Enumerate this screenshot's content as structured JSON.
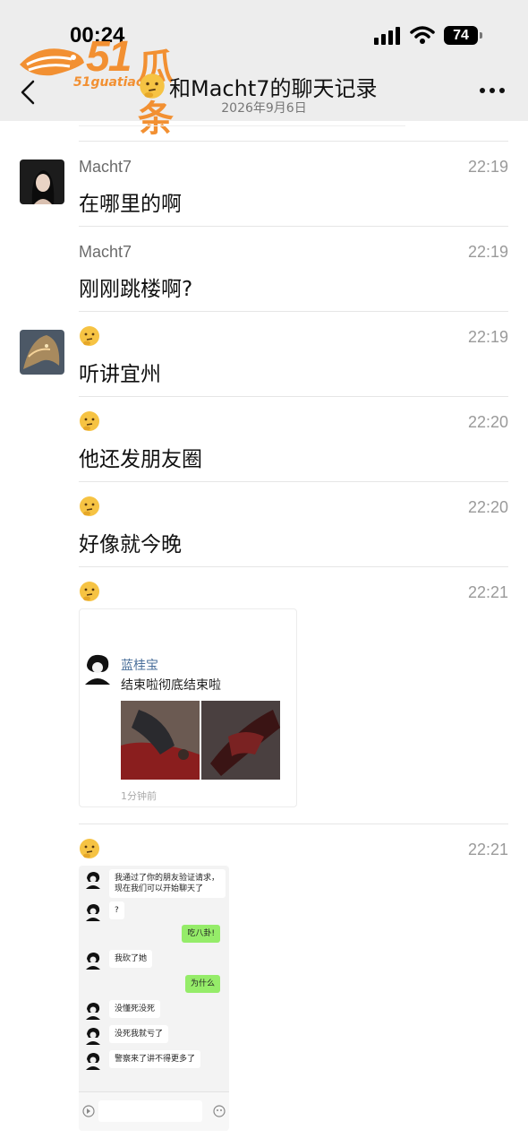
{
  "status_bar": {
    "time": "00:24",
    "battery": "74"
  },
  "watermark": {
    "number": "51",
    "name": "瓜条",
    "site": "51guatiao"
  },
  "nav": {
    "title": "和Macht7的聊天记录",
    "date": "2026年9月6日"
  },
  "messages": [
    {
      "sender": "Macht7",
      "time": "22:19",
      "text": "在哪里的啊"
    },
    {
      "sender": "Macht7",
      "time": "22:19",
      "text": "刚刚跳楼啊?"
    },
    {
      "sender_icon": "thinking-face-emoji",
      "time": "22:19",
      "text": "听讲宜州"
    },
    {
      "sender_icon": "thinking-face-emoji",
      "time": "22:20",
      "text": "他还发朋友圈"
    },
    {
      "sender_icon": "thinking-face-emoji",
      "time": "22:20",
      "text": "好像就今晚"
    },
    {
      "sender_icon": "thinking-face-emoji",
      "time": "22:21",
      "moment": {
        "name": "蓝桂宝",
        "text": "结束啦彻底结束啦",
        "ago": "1分钟前"
      }
    },
    {
      "sender_icon": "thinking-face-emoji",
      "time": "22:21",
      "screenshot": {
        "lines": [
          {
            "side": "left",
            "text": "我通过了你的朋友验证请求，现在我们可以开始聊天了"
          },
          {
            "side": "left",
            "text": "?"
          },
          {
            "side": "right",
            "text": "吃八卦!"
          },
          {
            "side": "left",
            "text": "我砍了她"
          },
          {
            "side": "right",
            "text": "为什么"
          },
          {
            "side": "left",
            "text": "没懂死没死"
          },
          {
            "side": "left",
            "text": "没死我就亏了"
          },
          {
            "side": "left",
            "text": "警察来了讲不得更多了"
          }
        ]
      }
    }
  ],
  "colors": {
    "header_bg": "#ededed",
    "watermark": "#f29032",
    "bubble_green": "#95ec69"
  }
}
